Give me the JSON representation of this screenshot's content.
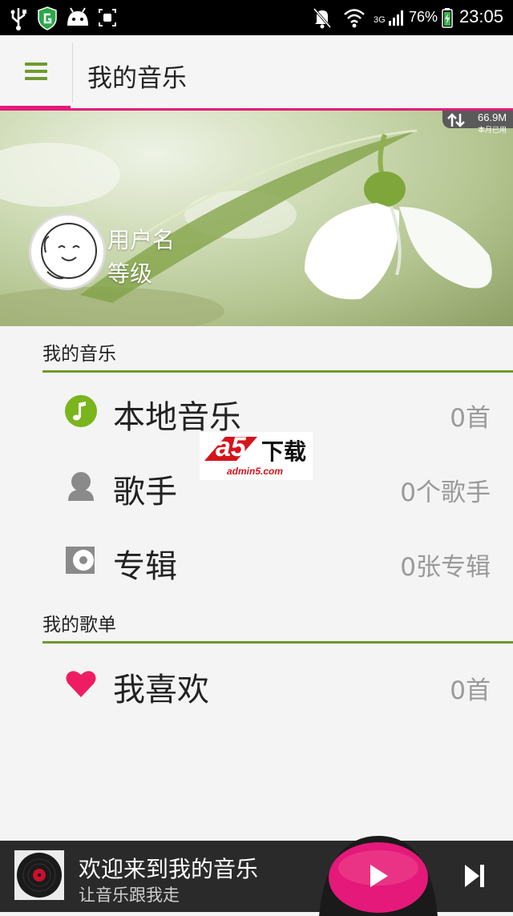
{
  "status_bar": {
    "battery": "76%",
    "time": "23:05",
    "network": "3G"
  },
  "app_bar": {
    "title": "我的音乐"
  },
  "hero": {
    "username": "用户名",
    "level": "等级",
    "data_usage_amount": "66.9M",
    "data_usage_label": "本月已用"
  },
  "sections": {
    "music": {
      "header": "我的音乐",
      "items": [
        {
          "label": "本地音乐",
          "count": "0首",
          "icon": "music-note-icon"
        },
        {
          "label": "歌手",
          "count": "0个歌手",
          "icon": "singer-icon"
        },
        {
          "label": "专辑",
          "count": "0张专辑",
          "icon": "album-icon"
        }
      ]
    },
    "playlists": {
      "header": "我的歌单",
      "items": [
        {
          "label": "我喜欢",
          "count": "0首",
          "icon": "heart-icon"
        }
      ]
    }
  },
  "watermark": {
    "logo": "a5",
    "text": "下载",
    "url": "admin5.com"
  },
  "player": {
    "title": "欢迎来到我的音乐",
    "subtitle": "让音乐跟我走"
  },
  "colors": {
    "accent": "#e4197a",
    "section_line": "#6f9a2d",
    "music_icon": "#7ab51d",
    "heart": "#ee1d63"
  }
}
